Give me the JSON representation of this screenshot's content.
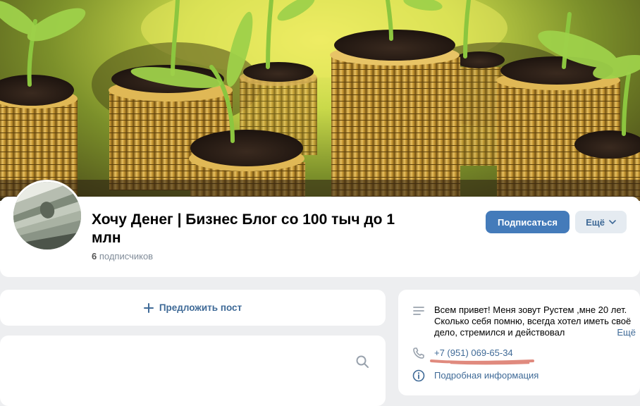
{
  "group": {
    "title": "Хочу Денег | Бизнес Блог со 100 тыч до 1 млн",
    "subscribers_count": "6",
    "subscribers_label": "подписчиков"
  },
  "actions": {
    "subscribe_label": "Подписаться",
    "more_label": "Ещё"
  },
  "wall": {
    "suggest_post_label": "Предложить пост"
  },
  "info": {
    "about": "Всем привет! Меня зовут Рустем ,мне 20 лет. Сколько себя помню, всегда хотел иметь своё дело, стремился и действовал",
    "about_more": "Ещё",
    "phone": "+7 (951) 069-65-34",
    "details_label": "Подробная информация"
  },
  "colors": {
    "accent": "#447bba",
    "link": "#3f6a97",
    "background": "#edeef0",
    "phone_underline": "#e08a7e"
  }
}
